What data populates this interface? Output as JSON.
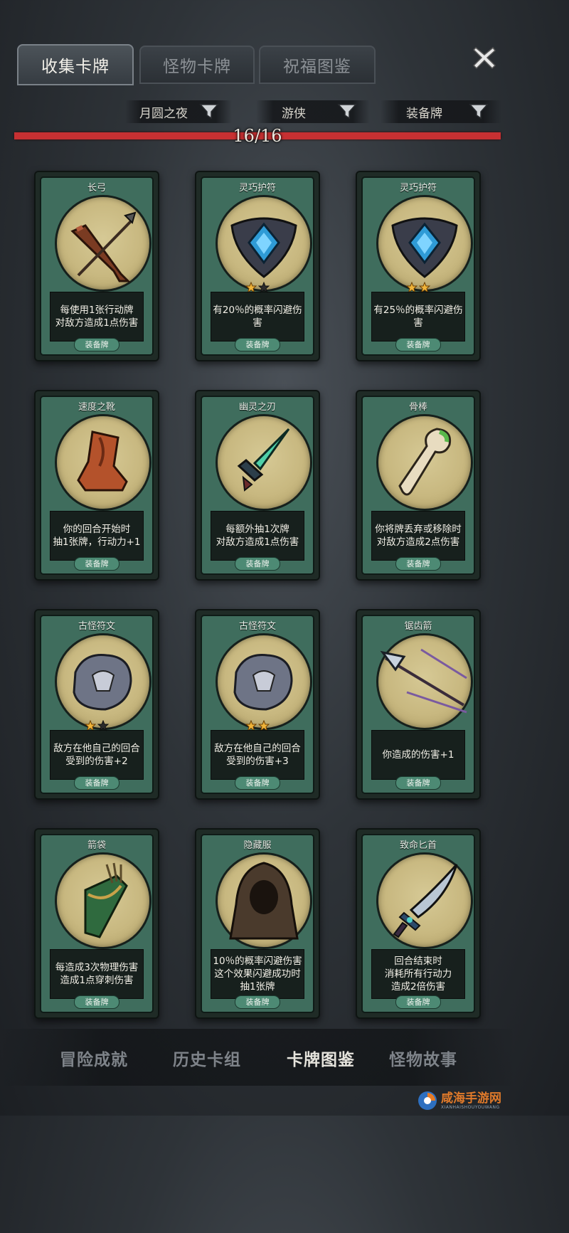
{
  "top_tabs": [
    {
      "label": "收集卡牌",
      "active": true
    },
    {
      "label": "怪物卡牌",
      "active": false
    },
    {
      "label": "祝福图鉴",
      "active": false
    }
  ],
  "filters": [
    {
      "label": "月圆之夜"
    },
    {
      "label": "游侠"
    },
    {
      "label": "装备牌"
    }
  ],
  "progress": {
    "text": "16/16",
    "fraction": 1.0
  },
  "cards": [
    {
      "title": "长弓",
      "desc": "每使用1张行动牌\n对敌方造成1点伤害",
      "type": "装备牌",
      "stars": 0,
      "icon": "longbow-icon"
    },
    {
      "title": "灵巧护符",
      "desc": "有20％的概率闪避伤害",
      "type": "装备牌",
      "stars": 1,
      "icon": "amulet-icon"
    },
    {
      "title": "灵巧护符",
      "desc": "有25％的概率闪避伤害",
      "type": "装备牌",
      "stars": 2,
      "icon": "amulet-icon"
    },
    {
      "title": "速度之靴",
      "desc": "你的回合开始时\n抽1张牌，行动力+1",
      "type": "装备牌",
      "stars": 0,
      "icon": "boots-icon"
    },
    {
      "title": "幽灵之刃",
      "desc": "每额外抽1次牌\n对敌方造成1点伤害",
      "type": "装备牌",
      "stars": 0,
      "icon": "ghost-blade-icon"
    },
    {
      "title": "骨棒",
      "desc": "你将牌丢弃或移除时\n对敌方造成2点伤害",
      "type": "装备牌",
      "stars": 0,
      "icon": "bone-club-icon"
    },
    {
      "title": "古怪符文",
      "desc": "敌方在他自己的回合\n受到的伤害+2",
      "type": "装备牌",
      "stars": 1,
      "icon": "rune-stone-icon"
    },
    {
      "title": "古怪符文",
      "desc": "敌方在他自己的回合\n受到的伤害+3",
      "type": "装备牌",
      "stars": 2,
      "icon": "rune-stone-icon"
    },
    {
      "title": "锯齿箭",
      "desc": "你造成的伤害+1",
      "type": "装备牌",
      "stars": 0,
      "icon": "serrated-arrow-icon"
    },
    {
      "title": "箭袋",
      "desc": "每造成3次物理伤害\n造成1点穿刺伤害",
      "type": "装备牌",
      "stars": 0,
      "icon": "quiver-icon"
    },
    {
      "title": "隐藏服",
      "desc": "10％的概率闪避伤害\n这个效果闪避成功时\n抽1张牌",
      "type": "装备牌",
      "stars": 0,
      "icon": "hood-cloak-icon"
    },
    {
      "title": "致命匕首",
      "desc": "回合结束时\n消耗所有行动力\n造成2倍伤害",
      "type": "装备牌",
      "stars": 0,
      "icon": "dagger-icon"
    }
  ],
  "bottom_nav": [
    {
      "label": "冒险成就",
      "active": false
    },
    {
      "label": "历史卡组",
      "active": false
    },
    {
      "label": "卡牌图鉴",
      "active": true
    },
    {
      "label": "怪物故事",
      "active": false
    }
  ],
  "watermark": {
    "text": "咸海手游网",
    "sub": "XIANHAISHOUYOUWANG"
  },
  "colors": {
    "accent_red": "#b3282b",
    "card_green": "#3f6d5d",
    "portrait_gold": "#c8b880",
    "star_gold": "#f0b43a"
  }
}
